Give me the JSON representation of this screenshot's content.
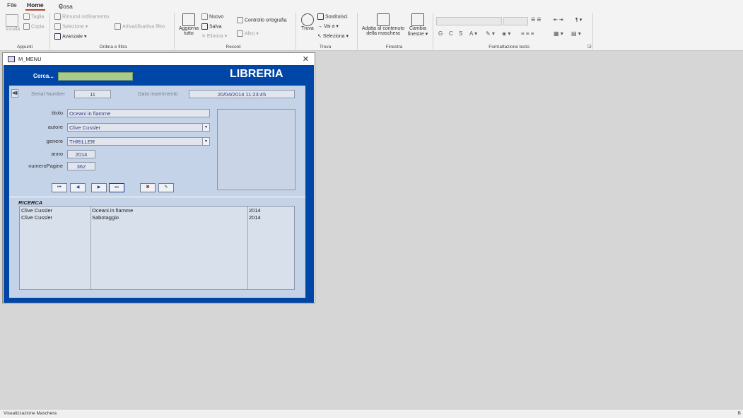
{
  "menu": {
    "file": "File",
    "home": "Home",
    "tell_me": "Cosa vuoi fare?"
  },
  "ribbon": {
    "appunti": {
      "incolla": "Incolla",
      "taglia": "Taglia",
      "copia": "Copia",
      "group": "Appunti"
    },
    "ordina": {
      "rimuovi": "Rimuovi ordinamento",
      "selezione": "Selezione",
      "avanzate": "Avanzate",
      "attiva": "Attiva/disattiva filtro",
      "group": "Ordina e filtra"
    },
    "record": {
      "aggiorna": "Aggiorna",
      "tutto": "tutto",
      "nuovo": "Nuovo",
      "salva": "Salva",
      "elimina": "Elimina",
      "controllo": "Controllo ortografia",
      "altro": "Altro",
      "group": "Record"
    },
    "trova": {
      "trova": "Trova",
      "sostituisci": "Sostituisci",
      "vaia": "Vai a",
      "seleziona": "Seleziona",
      "group": "Trova"
    },
    "finestra": {
      "adatta_1": "Adatta al contenuto",
      "adatta_2": "della maschera",
      "cambia_1": "Cambia",
      "cambia_2": "finestre",
      "group": "Finestra"
    },
    "formattazione": {
      "group": "Formattazione testo",
      "bold": "G",
      "italic": "C",
      "underline": "S"
    }
  },
  "window": {
    "title": "M_MENU",
    "close": "✕"
  },
  "form": {
    "search_label": "Cerca...",
    "search_value": "",
    "app_title": "LIBRERIA",
    "serial_label": "Serial Number",
    "serial_value": "11",
    "date_label": "Data inserimento",
    "date_value": "20/04/2014 11:23:45",
    "titolo_label": "titolo",
    "titolo_value": "Oceani in fiamme",
    "autore_label": "autore",
    "autore_value": "Clive Cussler",
    "genere_label": "genere",
    "genere_value": "THRILLER",
    "anno_label": "anno",
    "anno_value": "2014",
    "pagine_label": "numeroPagine",
    "pagine_value": "362"
  },
  "nav": {
    "first": "⏮",
    "prev": "◀",
    "next": "▶",
    "last": "⏭",
    "delete": "✖",
    "edit": "✎"
  },
  "ricerca": {
    "label": "RICERCA",
    "rows": [
      {
        "autore": "Clive Cussler",
        "titolo": "Oceani in fiamme",
        "anno": "2014"
      },
      {
        "autore": "Clive Cussler",
        "titolo": "Sabotaggio",
        "anno": "2014"
      }
    ]
  },
  "status": {
    "left": "Visualizzazione Maschera",
    "right": "B"
  },
  "colors": {
    "form_bg": "#0046a6",
    "panel_bg": "#c5d3e8",
    "search_bg": "#a6cb8a"
  }
}
